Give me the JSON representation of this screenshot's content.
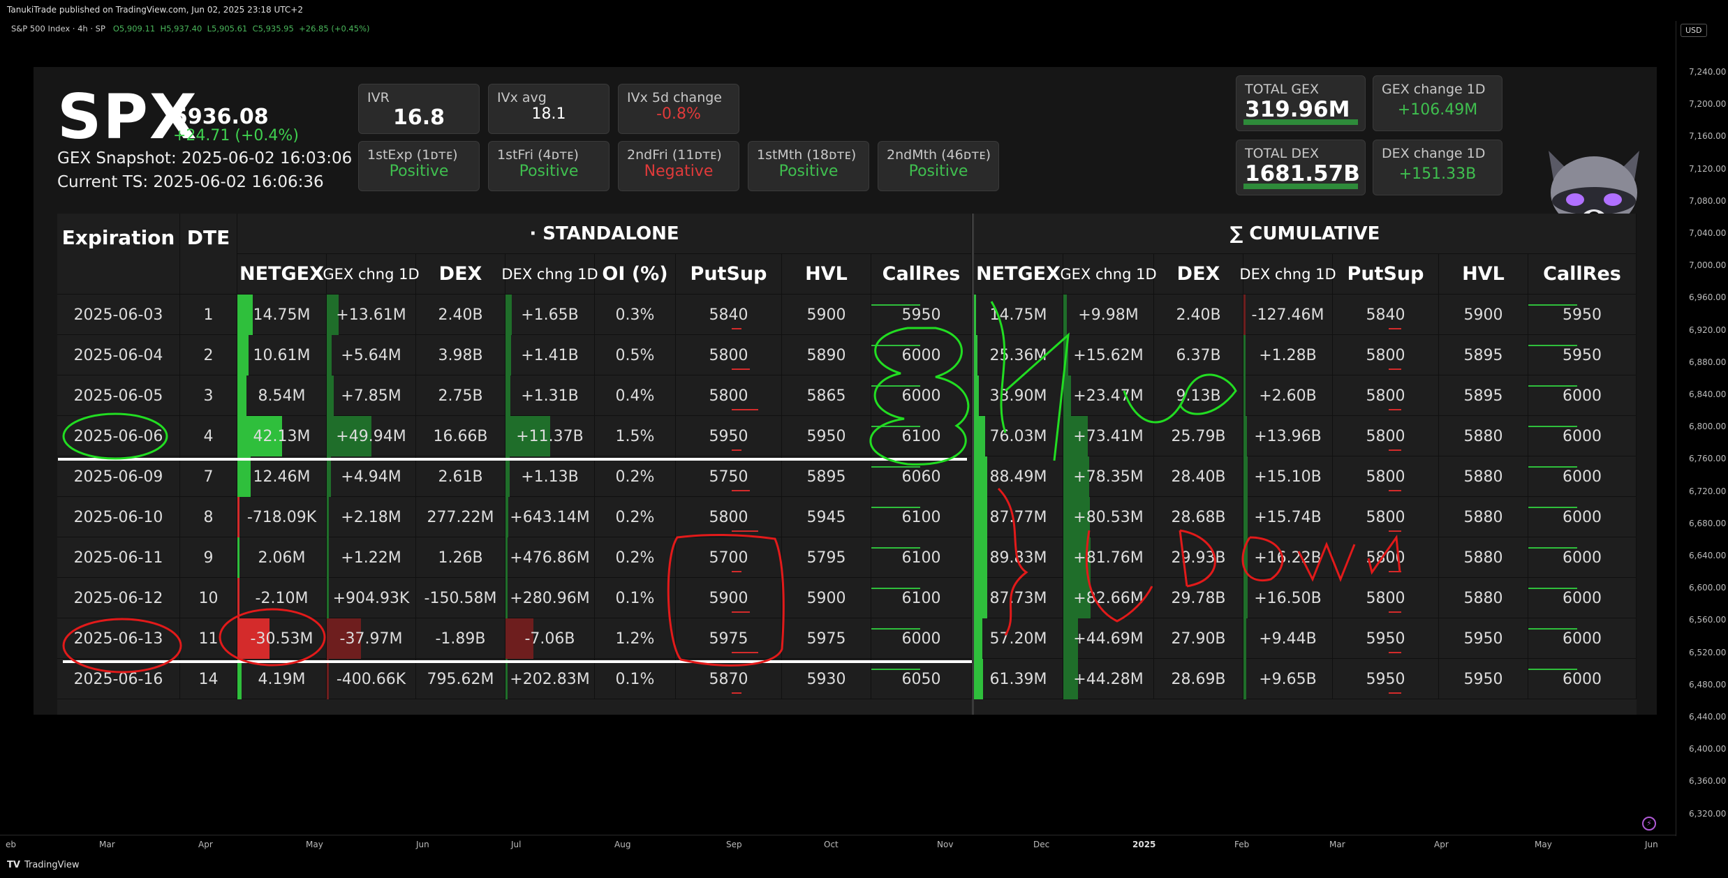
{
  "topbar": {
    "publish_note": "TanukiTrade published on TradingView.com, Jun 02, 2025 23:18 UTC+2"
  },
  "chart_info": {
    "symbol": "S&P 500 Index · 4h · SP",
    "open": "O5,909.11",
    "high": "H5,937.40",
    "low": "L5,905.61",
    "close": "C5,935.95",
    "change": "+26.85 (+0.45%)"
  },
  "price_axis": {
    "currency": "USD",
    "ticks": [
      "7,240.00",
      "7,200.00",
      "7,160.00",
      "7,120.00",
      "7,080.00",
      "7,040.00",
      "7,000.00",
      "6,960.00",
      "6,920.00",
      "6,880.00",
      "6,840.00",
      "6,800.00",
      "6,760.00",
      "6,720.00",
      "6,680.00",
      "6,640.00",
      "6,600.00",
      "6,560.00",
      "6,520.00",
      "6,480.00",
      "6,440.00",
      "6,400.00",
      "6,360.00",
      "6,320.00"
    ]
  },
  "time_axis": {
    "ticks": [
      {
        "label": "eb",
        "bold": false
      },
      {
        "label": "Mar",
        "bold": false
      },
      {
        "label": "Apr",
        "bold": false
      },
      {
        "label": "May",
        "bold": false
      },
      {
        "label": "Jun",
        "bold": false
      },
      {
        "label": "Jul",
        "bold": false
      },
      {
        "label": "Aug",
        "bold": false
      },
      {
        "label": "Sep",
        "bold": false
      },
      {
        "label": "Oct",
        "bold": false
      },
      {
        "label": "Nov",
        "bold": false
      },
      {
        "label": "Dec",
        "bold": false
      },
      {
        "label": "2025",
        "bold": true
      },
      {
        "label": "Feb",
        "bold": false
      },
      {
        "label": "Mar",
        "bold": false
      },
      {
        "label": "Apr",
        "bold": false
      },
      {
        "label": "May",
        "bold": false
      },
      {
        "label": "Jun",
        "bold": false
      }
    ]
  },
  "footer": {
    "brand_logo": "TV",
    "brand": "TradingView"
  },
  "header": {
    "ticker": "SPX",
    "price": "5936.08",
    "change": "+24.71 (+0.4%)",
    "snapshot": "GEX Snapshot: 2025-06-02 16:03:06",
    "current_ts": "Current TS: 2025-06-02 16:06:36"
  },
  "stats": {
    "ivr": {
      "label": "IVR",
      "value": "16.8"
    },
    "ivx_avg": {
      "label": "IVx avg",
      "value": "18.1"
    },
    "ivx_5d": {
      "label": "IVx 5d change",
      "value": "-0.8%"
    },
    "exp_1": {
      "label": "1stExp (1ᴅᴛᴇ)",
      "value": "Positive"
    },
    "exp_2": {
      "label": "1stFri (4ᴅᴛᴇ)",
      "value": "Positive"
    },
    "exp_3": {
      "label": "2ndFri (11ᴅᴛᴇ)",
      "value": "Negative"
    },
    "exp_4": {
      "label": "1stMth (18ᴅᴛᴇ)",
      "value": "Positive"
    },
    "exp_5": {
      "label": "2ndMth (46ᴅᴛᴇ)",
      "value": "Positive"
    },
    "total_gex": {
      "label": "TOTAL GEX",
      "value": "319.96M"
    },
    "gex_change": {
      "label": "GEX change 1D",
      "value": "+106.49M"
    },
    "total_dex": {
      "label": "TOTAL DEX",
      "value": "1681.57B"
    },
    "dex_change": {
      "label": "DEX change 1D",
      "value": "+151.33B"
    }
  },
  "table": {
    "expiration_header": "Expiration",
    "dte_header": "DTE",
    "standalone_title": "· STANDALONE",
    "cumulative_title": "∑ CUMULATIVE",
    "standalone_cols": [
      "NETGEX",
      "GEX chng 1D",
      "DEX",
      "DEX chng 1D",
      "OI (%)",
      "PutSup",
      "HVL",
      "CallRes"
    ],
    "cumulative_cols": [
      "NETGEX",
      "GEX chng 1D",
      "DEX",
      "DEX chng 1D",
      "PutSup",
      "HVL",
      "CallRes"
    ],
    "rows": [
      {
        "exp": "2025-06-03",
        "dte": "1",
        "s": [
          "14.75M",
          "+13.61M",
          "2.40B",
          "+1.65B",
          "0.3%",
          "5840",
          "5900",
          "5950"
        ],
        "c": [
          "14.75M",
          "+9.98M",
          "2.40B",
          "-127.46M",
          "5840",
          "5900",
          "5950"
        ]
      },
      {
        "exp": "2025-06-04",
        "dte": "2",
        "s": [
          "10.61M",
          "+5.64M",
          "3.98B",
          "+1.41B",
          "0.5%",
          "5800",
          "5890",
          "6000"
        ],
        "c": [
          "25.36M",
          "+15.62M",
          "6.37B",
          "+1.28B",
          "5800",
          "5895",
          "5950"
        ]
      },
      {
        "exp": "2025-06-05",
        "dte": "3",
        "s": [
          "8.54M",
          "+7.85M",
          "2.75B",
          "+1.31B",
          "0.4%",
          "5800",
          "5865",
          "6000"
        ],
        "c": [
          "33.90M",
          "+23.47M",
          "9.13B",
          "+2.60B",
          "5800",
          "5895",
          "6000"
        ]
      },
      {
        "exp": "2025-06-06",
        "dte": "4",
        "s": [
          "42.13M",
          "+49.94M",
          "16.66B",
          "+11.37B",
          "1.5%",
          "5950",
          "5950",
          "6100"
        ],
        "c": [
          "76.03M",
          "+73.41M",
          "25.79B",
          "+13.96B",
          "5800",
          "5880",
          "6000"
        ]
      },
      {
        "exp": "2025-06-09",
        "dte": "7",
        "s": [
          "12.46M",
          "+4.94M",
          "2.61B",
          "+1.13B",
          "0.2%",
          "5750",
          "5895",
          "6060"
        ],
        "c": [
          "88.49M",
          "+78.35M",
          "28.40B",
          "+15.10B",
          "5800",
          "5880",
          "6000"
        ]
      },
      {
        "exp": "2025-06-10",
        "dte": "8",
        "s": [
          "-718.09K",
          "+2.18M",
          "277.22M",
          "+643.14M",
          "0.2%",
          "5800",
          "5945",
          "6100"
        ],
        "c": [
          "87.77M",
          "+80.53M",
          "28.68B",
          "+15.74B",
          "5800",
          "5880",
          "6000"
        ]
      },
      {
        "exp": "2025-06-11",
        "dte": "9",
        "s": [
          "2.06M",
          "+1.22M",
          "1.26B",
          "+476.86M",
          "0.2%",
          "5700",
          "5795",
          "6100"
        ],
        "c": [
          "89.83M",
          "+81.76M",
          "29.93B",
          "+16.22B",
          "5800",
          "5880",
          "6000"
        ]
      },
      {
        "exp": "2025-06-12",
        "dte": "10",
        "s": [
          "-2.10M",
          "+904.93K",
          "-150.58M",
          "+280.96M",
          "0.1%",
          "5900",
          "5900",
          "6100"
        ],
        "c": [
          "87.73M",
          "+82.66M",
          "29.78B",
          "+16.50B",
          "5800",
          "5880",
          "6000"
        ]
      },
      {
        "exp": "2025-06-13",
        "dte": "11",
        "s": [
          "-30.53M",
          "-37.97M",
          "-1.89B",
          "-7.06B",
          "1.2%",
          "5975",
          "5975",
          "6000"
        ],
        "c": [
          "57.20M",
          "+44.69M",
          "27.90B",
          "+9.44B",
          "5950",
          "5950",
          "6000"
        ]
      },
      {
        "exp": "2025-06-16",
        "dte": "14",
        "s": [
          "4.19M",
          "-400.66K",
          "795.62M",
          "+202.83M",
          "0.1%",
          "5870",
          "5930",
          "6050"
        ],
        "c": [
          "61.39M",
          "+44.28M",
          "28.69B",
          "+9.65B",
          "5950",
          "5950",
          "6000"
        ]
      }
    ],
    "bar_colors": {
      "positive": "#2fbf3c",
      "positive_dark": "#1f6e2a",
      "negative": "#d42b2b",
      "negative_dark": "#6e1e1e"
    }
  },
  "annotations": {
    "up_text": "UP",
    "down_text": "DOWN",
    "up_color": "#22dd22",
    "down_color": "#e21a1a"
  }
}
